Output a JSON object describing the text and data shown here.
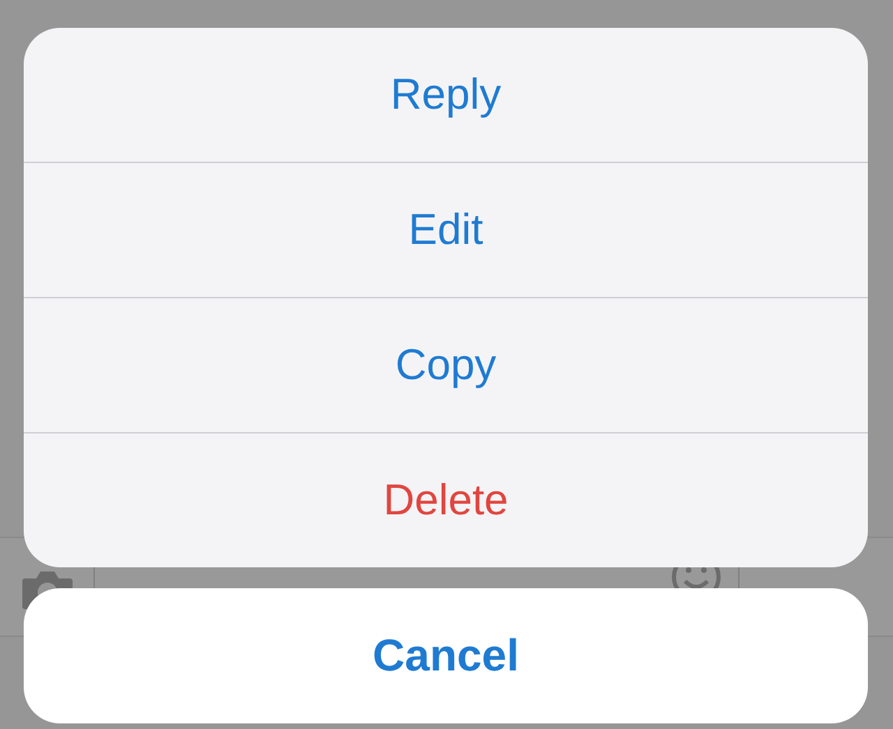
{
  "action_sheet": {
    "actions": [
      {
        "label": "Reply",
        "kind": "default"
      },
      {
        "label": "Edit",
        "kind": "default"
      },
      {
        "label": "Copy",
        "kind": "default"
      },
      {
        "label": "Delete",
        "kind": "destructive"
      }
    ],
    "cancel": {
      "label": "Cancel"
    }
  }
}
